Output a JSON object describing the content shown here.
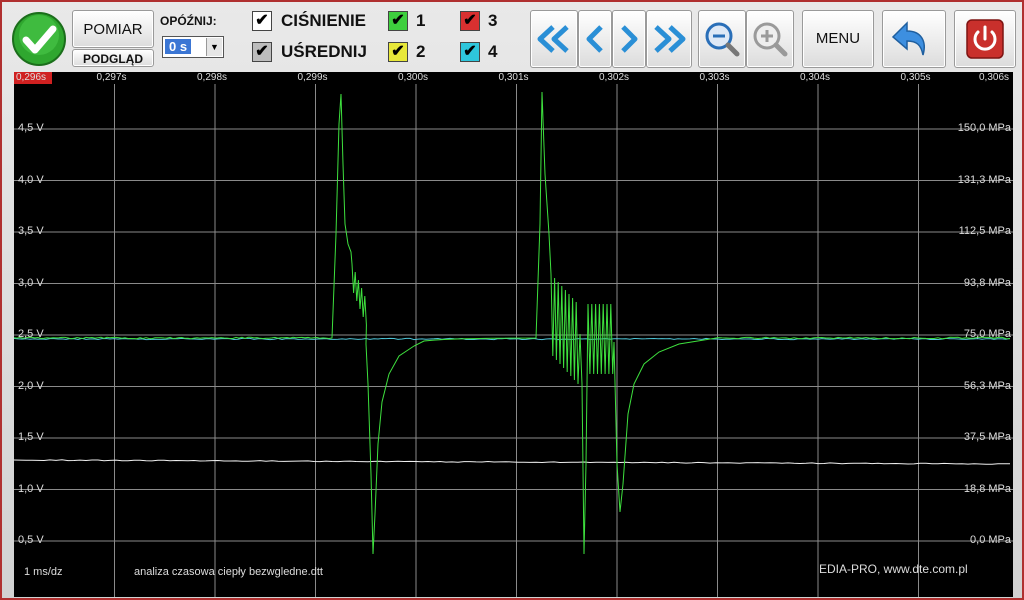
{
  "toolbar": {
    "pomiar_label": "POMIAR",
    "podglad_label": "PODGLĄD",
    "opoznij_label": "OPÓŹNIJ:",
    "delay_value": "0 s",
    "cisnienie_label": "CIŚNIENIE",
    "usredni_label": "UŚREDNIJ",
    "menu_label": "MENU",
    "channels": [
      {
        "label": "1",
        "color": "#3ecf3e"
      },
      {
        "label": "2",
        "color": "#e8e83a"
      },
      {
        "label": "3",
        "color": "#d93030"
      },
      {
        "label": "4",
        "color": "#2ec6dc"
      }
    ]
  },
  "ruler": {
    "ticks": [
      "0,296s",
      "0,297s",
      "0,298s",
      "0,299s",
      "0,300s",
      "0,301s",
      "0,302s",
      "0,303s",
      "0,304s",
      "0,305s",
      "0,306s"
    ]
  },
  "scope": {
    "voltage_labels": [
      "4,5 V",
      "4,0 V",
      "3,5 V",
      "3,0 V",
      "2,5 V",
      "2,0 V",
      "1,5 V",
      "1,0 V",
      "0,5 V"
    ],
    "pressure_labels": [
      "150,0 MPa",
      "131,3 MPa",
      "112,5 MPa",
      "93,8 MPa",
      "75,0 MPa",
      "56,3 MPa",
      "37,5 MPa",
      "18,8 MPa",
      "0,0 MPa"
    ],
    "time_scale": "1 ms/dz",
    "file_name": "analiza czasowa ciepły bezwgledne.dtt",
    "brand": "EDIA-PRO, www.dte.com.pl",
    "trace_colors": {
      "green": "#3ee03e",
      "cyan": "#4fc7d8",
      "white": "#f0f0f0"
    }
  }
}
